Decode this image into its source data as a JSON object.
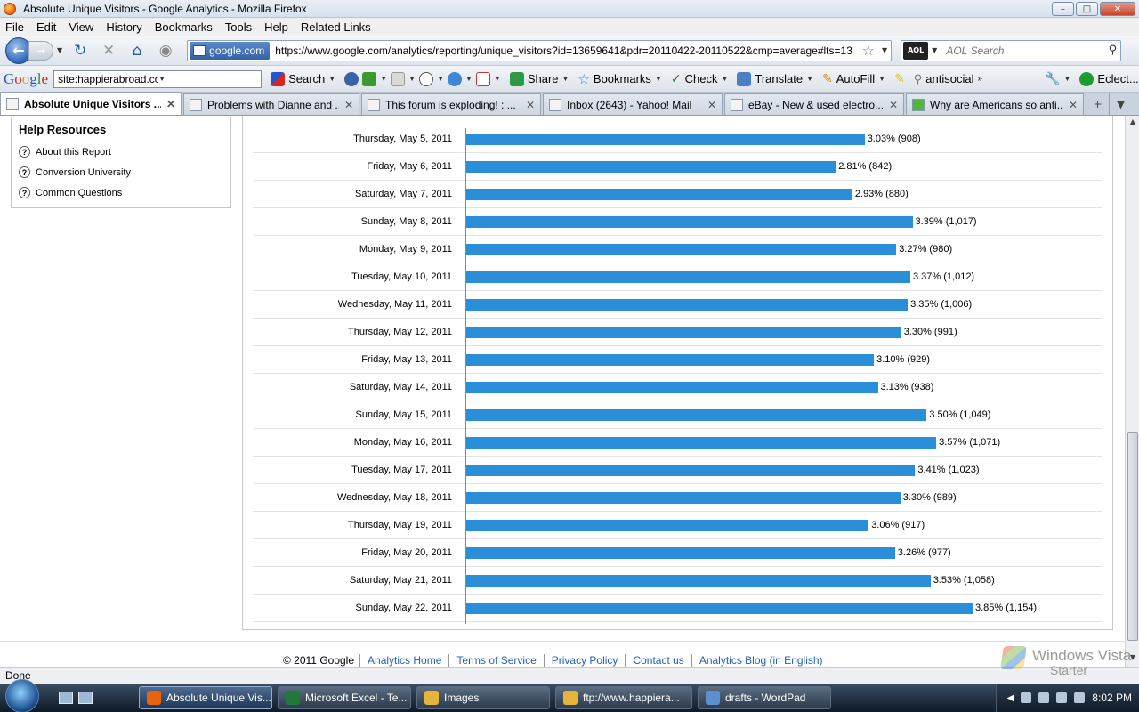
{
  "window": {
    "title": "Absolute Unique Visitors - Google Analytics - Mozilla Firefox"
  },
  "menu": [
    "File",
    "Edit",
    "View",
    "History",
    "Bookmarks",
    "Tools",
    "Help",
    "Related Links"
  ],
  "nav": {
    "site_identity": "google.com",
    "url": "https://www.google.com/analytics/reporting/unique_visitors?id=13659641&pdr=20110422-20110522&cmp=average#lts=13",
    "search_engine": "AOL",
    "search_placeholder": "AOL Search"
  },
  "google_toolbar": {
    "query": "site:happierabroad.com antisocial americ",
    "items": [
      "Search",
      "Share",
      "Bookmarks",
      "Check",
      "Translate",
      "AutoFill",
      "antisocial",
      "Eclect..."
    ]
  },
  "tabs": [
    {
      "label": "Absolute Unique Visitors ...",
      "active": true
    },
    {
      "label": "Problems with Dianne and ...",
      "active": false
    },
    {
      "label": "This forum is exploding! : ...",
      "active": false
    },
    {
      "label": "Inbox (2643) - Yahoo! Mail",
      "active": false
    },
    {
      "label": "eBay - New & used electro...",
      "active": false
    },
    {
      "label": "Why are Americans so anti...",
      "active": false
    }
  ],
  "help": {
    "title": "Help Resources",
    "links": [
      "About this Report",
      "Conversion University",
      "Common Questions"
    ]
  },
  "chart_data": {
    "type": "bar",
    "orientation": "horizontal",
    "categories": [
      "Thursday, May 5, 2011",
      "Friday, May 6, 2011",
      "Saturday, May 7, 2011",
      "Sunday, May 8, 2011",
      "Monday, May 9, 2011",
      "Tuesday, May 10, 2011",
      "Wednesday, May 11, 2011",
      "Thursday, May 12, 2011",
      "Friday, May 13, 2011",
      "Saturday, May 14, 2011",
      "Sunday, May 15, 2011",
      "Monday, May 16, 2011",
      "Tuesday, May 17, 2011",
      "Wednesday, May 18, 2011",
      "Thursday, May 19, 2011",
      "Friday, May 20, 2011",
      "Saturday, May 21, 2011",
      "Sunday, May 22, 2011"
    ],
    "values": [
      908,
      842,
      880,
      1017,
      980,
      1012,
      1006,
      991,
      929,
      938,
      1049,
      1071,
      1023,
      989,
      917,
      977,
      1058,
      1154
    ],
    "labels": [
      "3.03% (908)",
      "2.81% (842)",
      "2.93% (880)",
      "3.39% (1,017)",
      "3.27% (980)",
      "3.37% (1,012)",
      "3.35% (1,006)",
      "3.30% (991)",
      "3.10% (929)",
      "3.13% (938)",
      "3.50% (1,049)",
      "3.57% (1,071)",
      "3.41% (1,023)",
      "3.30% (989)",
      "3.06% (917)",
      "3.26% (977)",
      "3.53% (1,058)",
      "3.85% (1,154)"
    ],
    "bar_color": "#2b8ed9"
  },
  "footer": {
    "copyright": "© 2011 Google",
    "links": [
      "Analytics Home",
      "Terms of Service",
      "Privacy Policy",
      "Contact us",
      "Analytics Blog (in English)"
    ]
  },
  "status": {
    "text": "Done"
  },
  "watermark": {
    "line1": "Windows Vista",
    "line2": "Starter"
  },
  "taskbar": {
    "tasks": [
      {
        "label": "Absolute Unique Vis...",
        "active": true,
        "color": "#e8620f"
      },
      {
        "label": "Microsoft Excel - Te...",
        "active": false,
        "color": "#1f7a3a"
      },
      {
        "label": "Images",
        "active": false,
        "color": "#e5b43b"
      },
      {
        "label": "ftp://www.happiera...",
        "active": false,
        "color": "#e5b43b"
      },
      {
        "label": "drafts - WordPad",
        "active": false,
        "color": "#5a8fd0"
      }
    ],
    "clock": "8:02 PM"
  }
}
